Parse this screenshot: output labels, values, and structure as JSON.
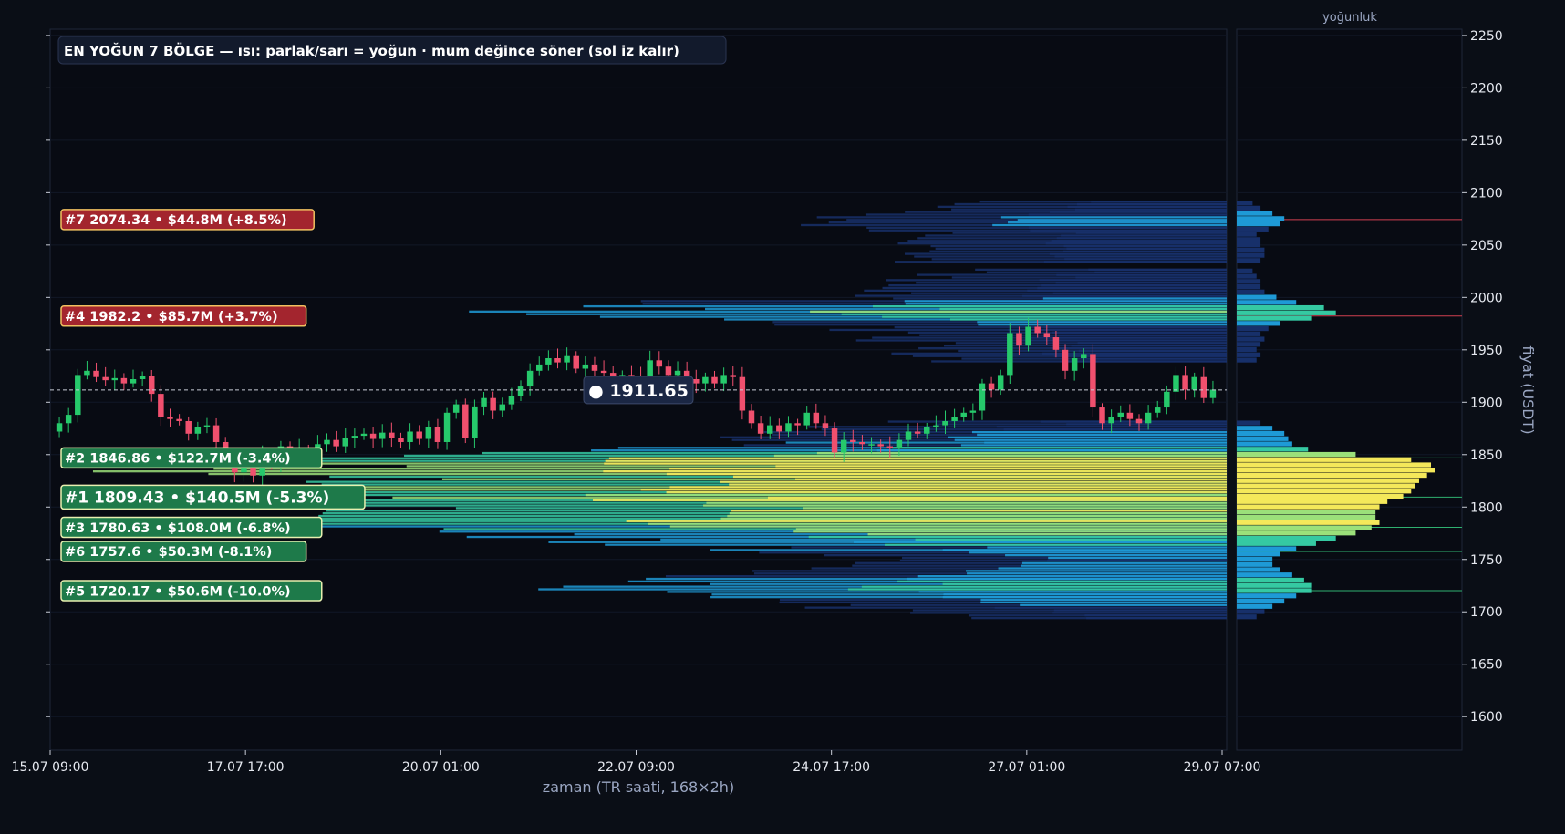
{
  "chart_data": [
    {
      "type": "heatmap",
      "title": "EN YOĞUN 7 BÖLGE — ısı: parlak/sarı = yoğun · mum değince söner (sol iz kalır)",
      "xlabel": "zaman (TR saati, 168×2h)",
      "ylabel": "fiyat (USDT)",
      "ylim": [
        1568,
        2256
      ],
      "x_ticks": [
        "15.07 09:00",
        "17.07 17:00",
        "20.07 01:00",
        "22.07 09:00",
        "24.07 17:00",
        "27.07 01:00",
        "29.07 07:00"
      ],
      "y_ticks": [
        1600,
        1650,
        1700,
        1750,
        1800,
        1850,
        1900,
        1950,
        2000,
        2050,
        2100,
        2150,
        2200,
        2250
      ],
      "current_price": 1911.65,
      "current_price_label": "● 1911.65",
      "zones": [
        {
          "rank": 7,
          "price": 2074.34,
          "label": "#7  2074.34  •  $44.8M  (+8.5%)",
          "side": "above"
        },
        {
          "rank": 4,
          "price": 1982.2,
          "label": "#4  1982.2  •  $85.7M  (+3.7%)",
          "side": "above"
        },
        {
          "rank": 2,
          "price": 1846.86,
          "label": "#2  1846.86  •  $122.7M  (-3.4%)",
          "side": "below"
        },
        {
          "rank": 1,
          "price": 1809.43,
          "label": "#1  1809.43  •  $140.5M  (-5.3%)",
          "side": "below"
        },
        {
          "rank": 3,
          "price": 1780.63,
          "label": "#3  1780.63  •  $108.0M  (-6.8%)",
          "side": "below"
        },
        {
          "rank": 6,
          "price": 1757.6,
          "label": "#6  1757.6  •  $50.3M  (-8.1%)",
          "side": "below"
        },
        {
          "rank": 5,
          "price": 1720.17,
          "label": "#5  1720.17  •  $50.6M  (-10.0%)",
          "side": "below"
        }
      ],
      "candles_approx": [
        [
          1872,
          1880
        ],
        [
          1880,
          1888
        ],
        [
          1888,
          1926
        ],
        [
          1926,
          1930
        ],
        [
          1930,
          1924
        ],
        [
          1924,
          1921
        ],
        [
          1921,
          1923
        ],
        [
          1923,
          1918
        ],
        [
          1918,
          1922
        ],
        [
          1922,
          1925
        ],
        [
          1925,
          1908
        ],
        [
          1908,
          1886
        ],
        [
          1886,
          1884
        ],
        [
          1884,
          1882
        ],
        [
          1882,
          1870
        ],
        [
          1870,
          1876
        ],
        [
          1876,
          1878
        ],
        [
          1878,
          1862
        ],
        [
          1862,
          1852
        ],
        [
          1852,
          1833
        ],
        [
          1833,
          1842
        ],
        [
          1842,
          1830
        ],
        [
          1830,
          1850
        ],
        [
          1850,
          1842
        ],
        [
          1842,
          1858
        ],
        [
          1858,
          1848
        ],
        [
          1848,
          1855
        ],
        [
          1855,
          1850
        ],
        [
          1850,
          1860
        ],
        [
          1860,
          1864
        ],
        [
          1864,
          1858
        ],
        [
          1858,
          1866
        ],
        [
          1866,
          1868
        ],
        [
          1868,
          1870
        ],
        [
          1870,
          1865
        ],
        [
          1865,
          1871
        ],
        [
          1871,
          1866
        ],
        [
          1866,
          1862
        ],
        [
          1862,
          1872
        ],
        [
          1872,
          1865
        ],
        [
          1865,
          1876
        ],
        [
          1876,
          1862
        ],
        [
          1862,
          1890
        ],
        [
          1890,
          1898
        ],
        [
          1898,
          1866
        ],
        [
          1866,
          1896
        ],
        [
          1896,
          1904
        ],
        [
          1904,
          1892
        ],
        [
          1892,
          1898
        ],
        [
          1898,
          1906
        ],
        [
          1906,
          1915
        ],
        [
          1915,
          1930
        ],
        [
          1930,
          1936
        ],
        [
          1936,
          1942
        ],
        [
          1942,
          1938
        ],
        [
          1938,
          1944
        ],
        [
          1944,
          1932
        ],
        [
          1932,
          1936
        ],
        [
          1936,
          1930
        ],
        [
          1930,
          1928
        ],
        [
          1928,
          1920
        ],
        [
          1920,
          1926
        ],
        [
          1926,
          1924
        ],
        [
          1924,
          1920
        ],
        [
          1920,
          1940
        ],
        [
          1940,
          1934
        ],
        [
          1934,
          1926
        ],
        [
          1926,
          1930
        ],
        [
          1930,
          1922
        ],
        [
          1922,
          1918
        ],
        [
          1918,
          1924
        ],
        [
          1924,
          1918
        ],
        [
          1918,
          1926
        ],
        [
          1926,
          1924
        ],
        [
          1924,
          1892
        ],
        [
          1892,
          1880
        ],
        [
          1880,
          1870
        ],
        [
          1870,
          1878
        ],
        [
          1878,
          1872
        ],
        [
          1872,
          1880
        ],
        [
          1880,
          1878
        ],
        [
          1878,
          1890
        ],
        [
          1890,
          1880
        ],
        [
          1880,
          1875
        ],
        [
          1875,
          1852
        ],
        [
          1852,
          1864
        ],
        [
          1864,
          1862
        ],
        [
          1862,
          1860
        ],
        [
          1860,
          1860
        ],
        [
          1860,
          1858
        ],
        [
          1858,
          1856
        ],
        [
          1856,
          1864
        ],
        [
          1864,
          1872
        ],
        [
          1872,
          1870
        ],
        [
          1870,
          1876
        ],
        [
          1876,
          1878
        ],
        [
          1878,
          1882
        ],
        [
          1882,
          1886
        ],
        [
          1886,
          1890
        ],
        [
          1890,
          1892
        ],
        [
          1892,
          1918
        ],
        [
          1918,
          1912
        ],
        [
          1912,
          1926
        ],
        [
          1926,
          1966
        ],
        [
          1966,
          1954
        ],
        [
          1954,
          1972
        ],
        [
          1972,
          1966
        ],
        [
          1966,
          1962
        ],
        [
          1962,
          1950
        ],
        [
          1950,
          1930
        ],
        [
          1930,
          1942
        ],
        [
          1942,
          1946
        ],
        [
          1946,
          1895
        ],
        [
          1895,
          1880
        ],
        [
          1880,
          1886
        ],
        [
          1886,
          1890
        ],
        [
          1890,
          1884
        ],
        [
          1884,
          1880
        ],
        [
          1880,
          1890
        ],
        [
          1890,
          1895
        ],
        [
          1895,
          1910
        ],
        [
          1910,
          1926
        ],
        [
          1926,
          1912
        ],
        [
          1912,
          1924
        ],
        [
          1924,
          1904
        ],
        [
          1904,
          1912
        ]
      ]
    },
    {
      "type": "bar",
      "title": "yoğunluk",
      "orientation": "horizontal",
      "profile_approx": [
        {
          "price": 1695,
          "v": 0.1
        },
        {
          "price": 1700,
          "v": 0.14
        },
        {
          "price": 1705,
          "v": 0.18
        },
        {
          "price": 1710,
          "v": 0.24
        },
        {
          "price": 1715,
          "v": 0.3
        },
        {
          "price": 1720,
          "v": 0.38
        },
        {
          "price": 1725,
          "v": 0.38
        },
        {
          "price": 1730,
          "v": 0.34
        },
        {
          "price": 1735,
          "v": 0.28
        },
        {
          "price": 1740,
          "v": 0.22
        },
        {
          "price": 1745,
          "v": 0.18
        },
        {
          "price": 1750,
          "v": 0.18
        },
        {
          "price": 1755,
          "v": 0.22
        },
        {
          "price": 1760,
          "v": 0.3
        },
        {
          "price": 1765,
          "v": 0.4
        },
        {
          "price": 1770,
          "v": 0.5
        },
        {
          "price": 1775,
          "v": 0.6
        },
        {
          "price": 1780,
          "v": 0.68
        },
        {
          "price": 1785,
          "v": 0.72
        },
        {
          "price": 1790,
          "v": 0.7
        },
        {
          "price": 1795,
          "v": 0.7
        },
        {
          "price": 1800,
          "v": 0.72
        },
        {
          "price": 1805,
          "v": 0.76
        },
        {
          "price": 1810,
          "v": 0.84
        },
        {
          "price": 1815,
          "v": 0.88
        },
        {
          "price": 1820,
          "v": 0.9
        },
        {
          "price": 1825,
          "v": 0.92
        },
        {
          "price": 1830,
          "v": 0.96
        },
        {
          "price": 1835,
          "v": 1.0
        },
        {
          "price": 1840,
          "v": 0.98
        },
        {
          "price": 1845,
          "v": 0.88
        },
        {
          "price": 1850,
          "v": 0.6
        },
        {
          "price": 1855,
          "v": 0.36
        },
        {
          "price": 1860,
          "v": 0.28
        },
        {
          "price": 1865,
          "v": 0.26
        },
        {
          "price": 1870,
          "v": 0.24
        },
        {
          "price": 1875,
          "v": 0.18
        },
        {
          "price": 1880,
          "v": 0.12
        },
        {
          "price": 1940,
          "v": 0.1
        },
        {
          "price": 1945,
          "v": 0.12
        },
        {
          "price": 1950,
          "v": 0.1
        },
        {
          "price": 1955,
          "v": 0.12
        },
        {
          "price": 1960,
          "v": 0.14
        },
        {
          "price": 1965,
          "v": 0.12
        },
        {
          "price": 1970,
          "v": 0.16
        },
        {
          "price": 1975,
          "v": 0.22
        },
        {
          "price": 1980,
          "v": 0.38
        },
        {
          "price": 1985,
          "v": 0.5
        },
        {
          "price": 1990,
          "v": 0.44
        },
        {
          "price": 1995,
          "v": 0.3
        },
        {
          "price": 2000,
          "v": 0.2
        },
        {
          "price": 2005,
          "v": 0.14
        },
        {
          "price": 2010,
          "v": 0.12
        },
        {
          "price": 2015,
          "v": 0.12
        },
        {
          "price": 2020,
          "v": 0.1
        },
        {
          "price": 2025,
          "v": 0.08
        },
        {
          "price": 2035,
          "v": 0.12
        },
        {
          "price": 2040,
          "v": 0.14
        },
        {
          "price": 2045,
          "v": 0.14
        },
        {
          "price": 2050,
          "v": 0.12
        },
        {
          "price": 2055,
          "v": 0.12
        },
        {
          "price": 2060,
          "v": 0.1
        },
        {
          "price": 2065,
          "v": 0.16
        },
        {
          "price": 2070,
          "v": 0.22
        },
        {
          "price": 2075,
          "v": 0.24
        },
        {
          "price": 2080,
          "v": 0.18
        },
        {
          "price": 2085,
          "v": 0.12
        },
        {
          "price": 2090,
          "v": 0.08
        }
      ]
    }
  ],
  "colors": {
    "background": "#0a0e16",
    "panel": "#080b13",
    "bull": "#26c96b",
    "bear": "#f0506e",
    "zone_above": "#a3252e",
    "zone_below": "#1e7a4a",
    "heat_low": "#17306a",
    "heat_mid": "#1e9ad6",
    "heat_high": "#35c9a2",
    "heat_top": "#f4e85a",
    "text": "#ffffff",
    "muted": "#9aa6c2"
  }
}
